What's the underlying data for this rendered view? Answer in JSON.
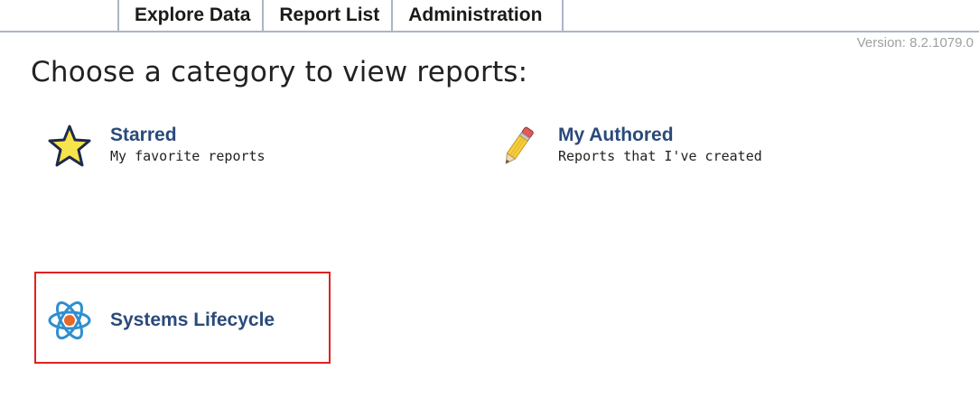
{
  "nav": {
    "tabs": [
      {
        "label": "Explore Data"
      },
      {
        "label": "Report List"
      },
      {
        "label": "Administration"
      }
    ]
  },
  "version": "Version: 8.2.1079.0",
  "page_title": "Choose a category to view reports:",
  "categories": [
    {
      "name": "Starred",
      "description": "My favorite reports",
      "icon": "star-icon"
    },
    {
      "name": "My Authored",
      "description": "Reports that I've created",
      "icon": "pencil-icon"
    },
    {
      "name": "Systems Lifecycle",
      "description": "",
      "icon": "atom-icon",
      "highlighted": true
    }
  ],
  "colors": {
    "link": "#2a4a7a",
    "highlight": "#e02020",
    "tab_divider": "#a9b6c6",
    "version_text": "#a0a0a0"
  }
}
